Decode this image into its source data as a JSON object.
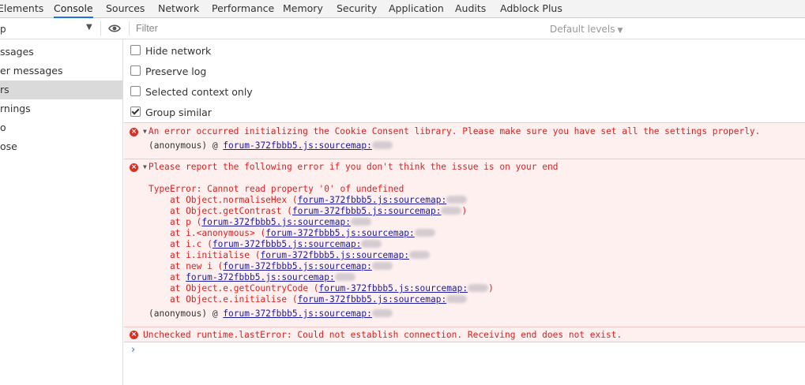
{
  "tabs": [
    "Elements",
    "Console",
    "Sources",
    "Network",
    "Performance",
    "Memory",
    "Security",
    "Application",
    "Audits",
    "Adblock Plus"
  ],
  "toolbar": {
    "context": "p",
    "filter_placeholder": "Filter",
    "levels": "Default levels"
  },
  "sidebar": {
    "items": [
      "ssages",
      "er messages",
      "rs",
      "rnings",
      "o",
      "ose"
    ],
    "selected_index": 2
  },
  "settings": [
    {
      "label": "Hide network",
      "checked": false
    },
    {
      "label": "Preserve log",
      "checked": false
    },
    {
      "label": "Selected context only",
      "checked": false
    },
    {
      "label": "Group similar",
      "checked": true
    }
  ],
  "console": {
    "msg1": {
      "text": "An error occurred initializing the Cookie Consent library. Please make sure you have set all the settings properly.",
      "origin_prefix": "(anonymous) @ ",
      "origin_link": "forum-372fbbb5.js:sourcemap:"
    },
    "msg2": {
      "text": "Please report the following error if you don't think the issue is on your end",
      "error": "TypeError: Cannot read property '0' of undefined",
      "stack": [
        {
          "prefix": "    at Object.normaliseHex (",
          "link": "forum-372fbbb5.js:sourcemap:",
          "suffix": ""
        },
        {
          "prefix": "    at Object.getContrast (",
          "link": "forum-372fbbb5.js:sourcemap:",
          "suffix": ")"
        },
        {
          "prefix": "    at p (",
          "link": "forum-372fbbb5.js:sourcemap:",
          "suffix": ""
        },
        {
          "prefix": "    at i.<anonymous> (",
          "link": "forum-372fbbb5.js:sourcemap:",
          "suffix": ""
        },
        {
          "prefix": "    at i.c (",
          "link": "forum-372fbbb5.js:sourcemap:",
          "suffix": ""
        },
        {
          "prefix": "    at i.initialise (",
          "link": "forum-372fbbb5.js:sourcemap:",
          "suffix": ""
        },
        {
          "prefix": "    at new i (",
          "link": "forum-372fbbb5.js:sourcemap:",
          "suffix": ""
        },
        {
          "prefix": "    at ",
          "link": "forum-372fbbb5.js:sourcemap:",
          "suffix": ""
        },
        {
          "prefix": "    at Object.e.getCountryCode (",
          "link": "forum-372fbbb5.js:sourcemap:",
          "suffix": ")"
        },
        {
          "prefix": "    at Object.e.initialise (",
          "link": "forum-372fbbb5.js:sourcemap:",
          "suffix": ""
        }
      ],
      "origin_prefix": "(anonymous) @ ",
      "origin_link": "forum-372fbbb5.js:sourcemap:"
    },
    "msg3": {
      "text": "Unchecked runtime.lastError: Could not establish connection. Receiving end does not exist."
    },
    "prompt": "›"
  },
  "colors": {
    "error_bg": "#fff0f0",
    "error_text": "#e02020",
    "link": "#1a1aa6",
    "active_tab": "#1a73e8"
  },
  "icons": [
    "eye-icon",
    "error-icon",
    "expand-triangle-icon",
    "dropdown-caret-icon",
    "prompt-chevron-icon"
  ]
}
